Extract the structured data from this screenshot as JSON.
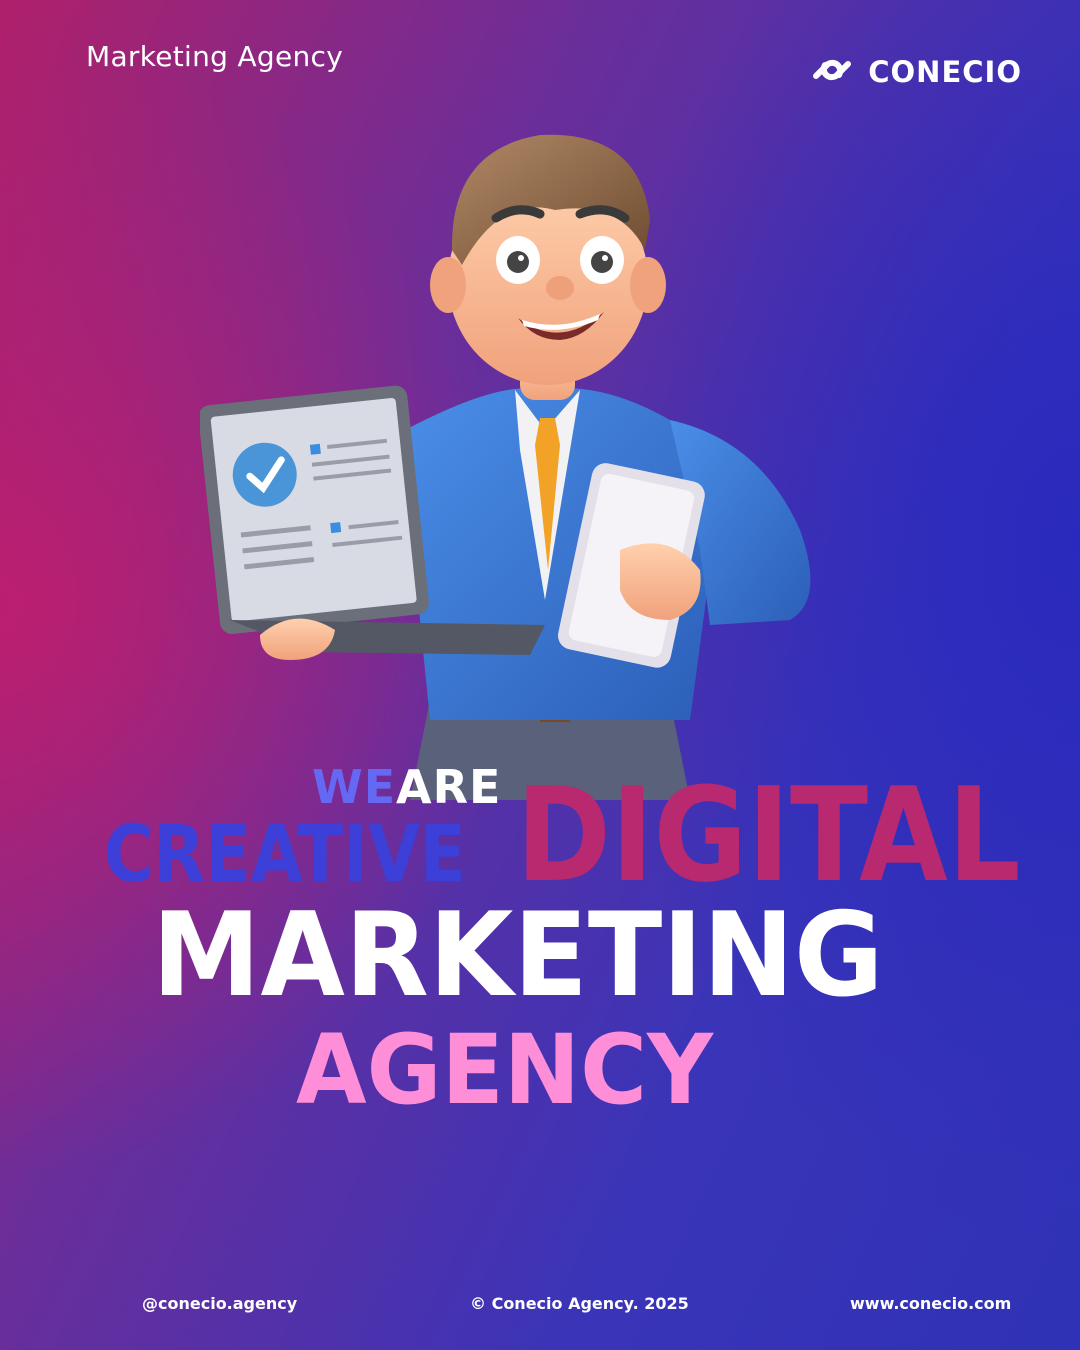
{
  "header": {
    "label": "Marketing Agency",
    "brand": "CONECIO",
    "logo_icon": "chain-link-icon"
  },
  "headline": {
    "we": "WE",
    "are": "ARE",
    "creative": "CREATIVE",
    "digital": "DIGITAL",
    "marketing": "MARKETING",
    "agency": "AGENCY"
  },
  "illustration": {
    "subject": "businessman-with-laptop-and-tablet"
  },
  "footer": {
    "handle": "@conecio.agency",
    "copyright": "© Conecio Agency. 2025",
    "website": "www.conecio.com"
  },
  "colors": {
    "background_left": "#b0206a",
    "background_right": "#2f32b6",
    "we_color": "#6468f2",
    "creative_color": "#3c3fd8",
    "digital_color": "#b8296f",
    "agency_color": "#ff8ed8"
  }
}
